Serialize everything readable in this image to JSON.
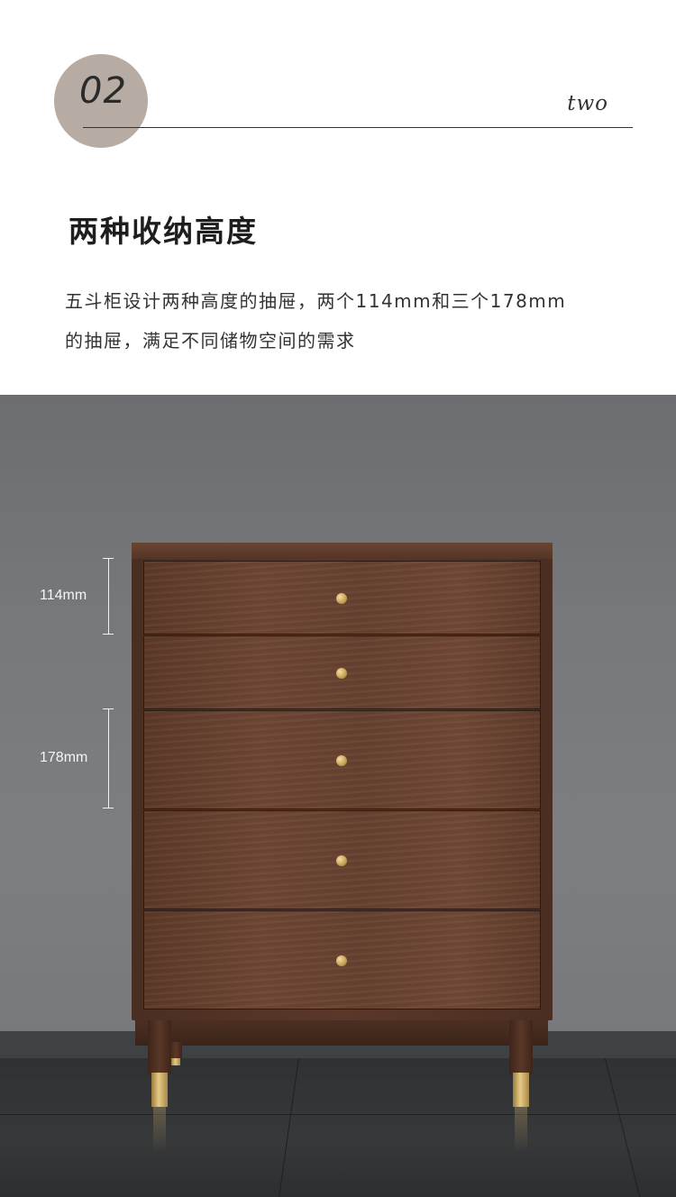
{
  "header": {
    "section_number": "02",
    "section_word": "two",
    "title": "两种收纳高度",
    "description_lines": [
      "五斗柜设计两种高度的抽屉，两个114mm和三个178mm",
      "的抽屉，满足不同储物空间的需求"
    ]
  },
  "photo": {
    "measurements": [
      {
        "label": "114mm"
      },
      {
        "label": "178mm"
      }
    ],
    "drawer_count": 5,
    "colors": {
      "wall": "#76787b",
      "wood": "#65402f",
      "brass": "#d4b36a",
      "floor": "#333537"
    }
  }
}
